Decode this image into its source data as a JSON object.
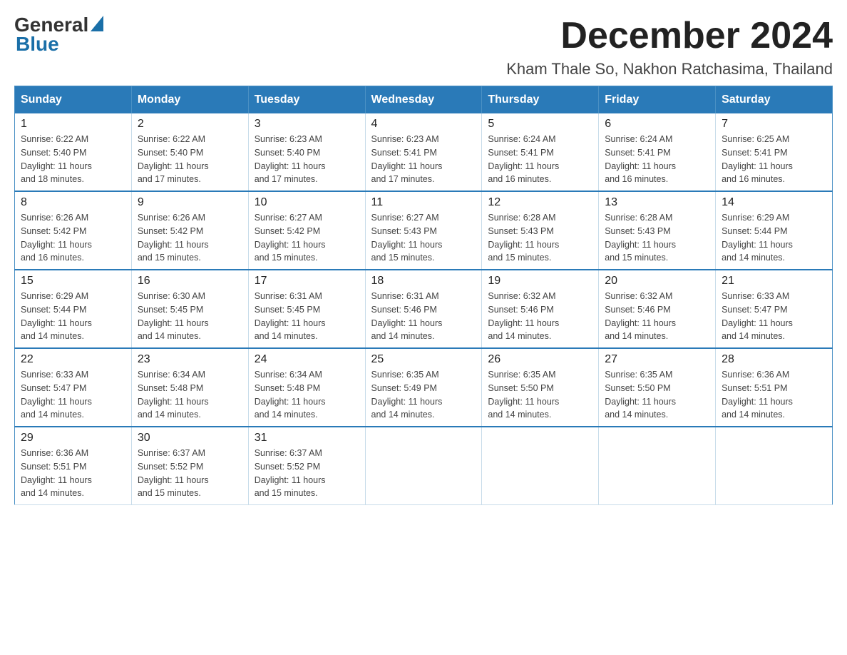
{
  "header": {
    "logo_general": "General",
    "logo_blue": "Blue",
    "title": "December 2024",
    "subtitle": "Kham Thale So, Nakhon Ratchasima, Thailand"
  },
  "days_of_week": [
    "Sunday",
    "Monday",
    "Tuesday",
    "Wednesday",
    "Thursday",
    "Friday",
    "Saturday"
  ],
  "weeks": [
    [
      {
        "day": 1,
        "sunrise": "6:22 AM",
        "sunset": "5:40 PM",
        "daylight": "11 hours and 18 minutes."
      },
      {
        "day": 2,
        "sunrise": "6:22 AM",
        "sunset": "5:40 PM",
        "daylight": "11 hours and 17 minutes."
      },
      {
        "day": 3,
        "sunrise": "6:23 AM",
        "sunset": "5:40 PM",
        "daylight": "11 hours and 17 minutes."
      },
      {
        "day": 4,
        "sunrise": "6:23 AM",
        "sunset": "5:41 PM",
        "daylight": "11 hours and 17 minutes."
      },
      {
        "day": 5,
        "sunrise": "6:24 AM",
        "sunset": "5:41 PM",
        "daylight": "11 hours and 16 minutes."
      },
      {
        "day": 6,
        "sunrise": "6:24 AM",
        "sunset": "5:41 PM",
        "daylight": "11 hours and 16 minutes."
      },
      {
        "day": 7,
        "sunrise": "6:25 AM",
        "sunset": "5:41 PM",
        "daylight": "11 hours and 16 minutes."
      }
    ],
    [
      {
        "day": 8,
        "sunrise": "6:26 AM",
        "sunset": "5:42 PM",
        "daylight": "11 hours and 16 minutes."
      },
      {
        "day": 9,
        "sunrise": "6:26 AM",
        "sunset": "5:42 PM",
        "daylight": "11 hours and 15 minutes."
      },
      {
        "day": 10,
        "sunrise": "6:27 AM",
        "sunset": "5:42 PM",
        "daylight": "11 hours and 15 minutes."
      },
      {
        "day": 11,
        "sunrise": "6:27 AM",
        "sunset": "5:43 PM",
        "daylight": "11 hours and 15 minutes."
      },
      {
        "day": 12,
        "sunrise": "6:28 AM",
        "sunset": "5:43 PM",
        "daylight": "11 hours and 15 minutes."
      },
      {
        "day": 13,
        "sunrise": "6:28 AM",
        "sunset": "5:43 PM",
        "daylight": "11 hours and 15 minutes."
      },
      {
        "day": 14,
        "sunrise": "6:29 AM",
        "sunset": "5:44 PM",
        "daylight": "11 hours and 14 minutes."
      }
    ],
    [
      {
        "day": 15,
        "sunrise": "6:29 AM",
        "sunset": "5:44 PM",
        "daylight": "11 hours and 14 minutes."
      },
      {
        "day": 16,
        "sunrise": "6:30 AM",
        "sunset": "5:45 PM",
        "daylight": "11 hours and 14 minutes."
      },
      {
        "day": 17,
        "sunrise": "6:31 AM",
        "sunset": "5:45 PM",
        "daylight": "11 hours and 14 minutes."
      },
      {
        "day": 18,
        "sunrise": "6:31 AM",
        "sunset": "5:46 PM",
        "daylight": "11 hours and 14 minutes."
      },
      {
        "day": 19,
        "sunrise": "6:32 AM",
        "sunset": "5:46 PM",
        "daylight": "11 hours and 14 minutes."
      },
      {
        "day": 20,
        "sunrise": "6:32 AM",
        "sunset": "5:46 PM",
        "daylight": "11 hours and 14 minutes."
      },
      {
        "day": 21,
        "sunrise": "6:33 AM",
        "sunset": "5:47 PM",
        "daylight": "11 hours and 14 minutes."
      }
    ],
    [
      {
        "day": 22,
        "sunrise": "6:33 AM",
        "sunset": "5:47 PM",
        "daylight": "11 hours and 14 minutes."
      },
      {
        "day": 23,
        "sunrise": "6:34 AM",
        "sunset": "5:48 PM",
        "daylight": "11 hours and 14 minutes."
      },
      {
        "day": 24,
        "sunrise": "6:34 AM",
        "sunset": "5:48 PM",
        "daylight": "11 hours and 14 minutes."
      },
      {
        "day": 25,
        "sunrise": "6:35 AM",
        "sunset": "5:49 PM",
        "daylight": "11 hours and 14 minutes."
      },
      {
        "day": 26,
        "sunrise": "6:35 AM",
        "sunset": "5:50 PM",
        "daylight": "11 hours and 14 minutes."
      },
      {
        "day": 27,
        "sunrise": "6:35 AM",
        "sunset": "5:50 PM",
        "daylight": "11 hours and 14 minutes."
      },
      {
        "day": 28,
        "sunrise": "6:36 AM",
        "sunset": "5:51 PM",
        "daylight": "11 hours and 14 minutes."
      }
    ],
    [
      {
        "day": 29,
        "sunrise": "6:36 AM",
        "sunset": "5:51 PM",
        "daylight": "11 hours and 14 minutes."
      },
      {
        "day": 30,
        "sunrise": "6:37 AM",
        "sunset": "5:52 PM",
        "daylight": "11 hours and 15 minutes."
      },
      {
        "day": 31,
        "sunrise": "6:37 AM",
        "sunset": "5:52 PM",
        "daylight": "11 hours and 15 minutes."
      },
      null,
      null,
      null,
      null
    ]
  ],
  "label_sunrise": "Sunrise:",
  "label_sunset": "Sunset:",
  "label_daylight": "Daylight:"
}
